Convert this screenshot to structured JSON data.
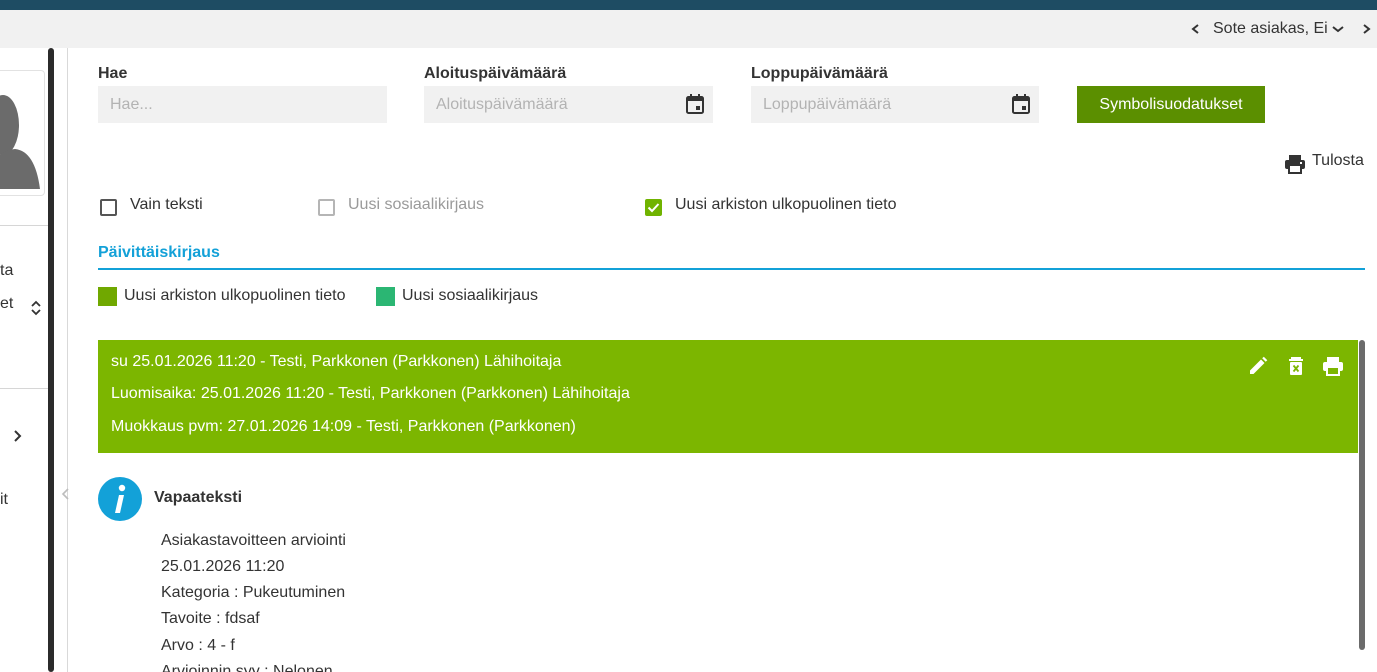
{
  "header": {
    "context_label": "Sote asiakas, Ei"
  },
  "left_panel": {
    "items": [
      "ta",
      "et",
      "it"
    ]
  },
  "filters": {
    "search": {
      "label": "Hae",
      "placeholder": "Hae..."
    },
    "start_date": {
      "label": "Aloituspäivämäärä",
      "placeholder": "Aloituspäivämäärä"
    },
    "end_date": {
      "label": "Loppupäivämäärä",
      "placeholder": "Loppupäivämäärä"
    },
    "symbol_filter_button": "Symbolisuodatukset"
  },
  "print_label": "Tulosta",
  "checkboxes": [
    {
      "label": "Vain teksti",
      "checked": false,
      "disabled": false
    },
    {
      "label": "Uusi sosiaalikirjaus",
      "checked": false,
      "disabled": true
    },
    {
      "label": "Uusi arkiston ulkopuolinen tieto",
      "checked": true,
      "disabled": false
    }
  ],
  "section_title": "Päivittäiskirjaus",
  "legend": [
    {
      "label": "Uusi arkiston ulkopuolinen tieto",
      "color": "#70a800"
    },
    {
      "label": "Uusi sosiaalikirjaus",
      "color": "#2bb673"
    }
  ],
  "entry": {
    "header_lines": [
      "su 25.01.2026 11:20 - Testi, Parkkonen (Parkkonen) Lähihoitaja",
      "Luomisaika: 25.01.2026 11:20 - Testi, Parkkonen (Parkkonen) Lähihoitaja",
      "Muokkaus pvm: 27.01.2026 14:09 - Testi, Parkkonen (Parkkonen)"
    ],
    "actions": [
      "edit-icon",
      "delete-icon",
      "print-icon"
    ],
    "body_title": "Vapaateksti",
    "body_lines": [
      "Asiakastavoitteen arviointi",
      "25.01.2026 11:20",
      "Kategoria : Pukeutuminen",
      "Tavoite : fdsaf",
      "Arvo : 4 - f",
      "Arvioinnin syy : Nelonen"
    ]
  },
  "colors": {
    "top_bar": "#1e4c63",
    "accent_blue": "#13a1d8",
    "entry_green": "#7cb600",
    "button_green": "#5b8f00"
  }
}
